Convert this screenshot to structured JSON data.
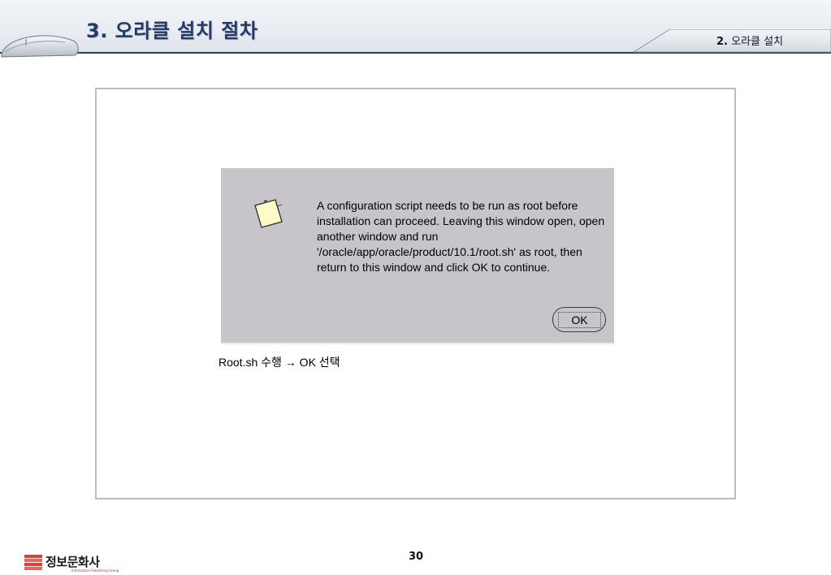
{
  "header": {
    "title_number": "3.",
    "title_text": " 오라클 설치 절차",
    "section_number": "2.",
    "section_text": " 오라클 설치"
  },
  "dialog": {
    "message": "A configuration script needs to be run as root before installation can proceed. Leaving this window open, open another window and run '/oracle/app/oracle/product/10.1/root.sh' as root, then return to this window and click OK to continue.",
    "ok_label": "OK",
    "icon": "note-icon"
  },
  "caption": "Root.sh 수행 → OK 선택",
  "footer": {
    "logo_name": "정보문화사",
    "logo_sub": "Information Publishing Group",
    "page_number": "30"
  },
  "colors": {
    "title": "#243a63",
    "dialog_bg": "#c7c5c9",
    "header_line": "#2f3a4a",
    "logo_accent": "#d9413a"
  }
}
